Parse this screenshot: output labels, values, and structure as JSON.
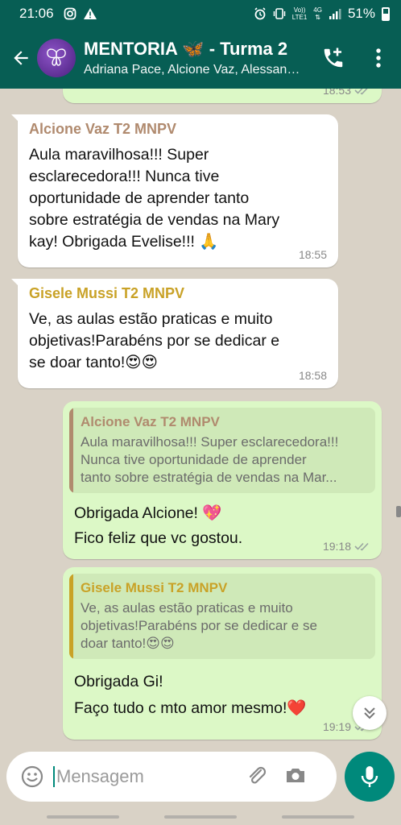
{
  "status_bar": {
    "time": "21:06",
    "network_labels": [
      "Vo))",
      "LTE1"
    ],
    "network_type": "4G",
    "battery": "51%",
    "icons": [
      "instagram-icon",
      "warning-icon",
      "alarm-icon",
      "vibrate-icon",
      "signal-icon",
      "battery-icon"
    ]
  },
  "header": {
    "title": "MENTORIA 🦋 - Turma 2",
    "subtitle": "Adriana Pace, Alcione Vaz, Alessandra...",
    "icons": [
      "back-arrow-icon",
      "group-avatar",
      "add-call-icon",
      "more-options-icon"
    ]
  },
  "messages": [
    {
      "type": "outgoing",
      "time": "18:53",
      "read": true
    },
    {
      "type": "incoming",
      "sender": "Alcione Vaz T2 MNPV",
      "sender_color": "#b08a6e",
      "lines": [
        "Aula maravilhosa!!! Super",
        "esclarecedora!!! Nunca tive",
        "oportunidade de aprender tanto",
        "sobre estratégia de vendas na Mary",
        "kay! Obrigada Evelise!!! 🙏"
      ],
      "time": "18:55"
    },
    {
      "type": "incoming",
      "sender": "Gisele Mussi T2 MNPV",
      "sender_color": "#c9a227",
      "lines": [
        "Ve, as aulas estão praticas e muito",
        "objetivas!Parabéns por se dedicar e",
        "se doar tanto!😍😍"
      ],
      "time": "18:58"
    },
    {
      "type": "outgoing",
      "quote": {
        "sender": "Alcione Vaz T2 MNPV",
        "color": "#b08a6e",
        "lines": [
          "Aula maravilhosa!!! Super esclarecedora!!!",
          "Nunca tive oportunidade de aprender",
          "tanto sobre estratégia de vendas na Mar..."
        ]
      },
      "lines": [
        "Obrigada Alcione! 💖",
        "Fico feliz que vc gostou."
      ],
      "time": "19:18",
      "read": true
    },
    {
      "type": "outgoing",
      "quote": {
        "sender": "Gisele Mussi T2 MNPV",
        "color": "#c9a227",
        "lines": [
          "Ve, as aulas estão praticas e muito",
          "objetivas!Parabéns por se dedicar e se",
          "doar tanto!😍😍"
        ]
      },
      "lines": [
        "Obrigada Gi!",
        "Faço tudo c mto amor mesmo!❤️"
      ],
      "time": "19:19",
      "read": true
    }
  ],
  "input": {
    "placeholder": "Mensagem"
  },
  "colors": {
    "header": "#075e54",
    "outgoing_bubble": "#dcf8c6",
    "incoming_bubble": "#ffffff",
    "accent": "#00897b",
    "chat_background": "#d9d2c6"
  }
}
